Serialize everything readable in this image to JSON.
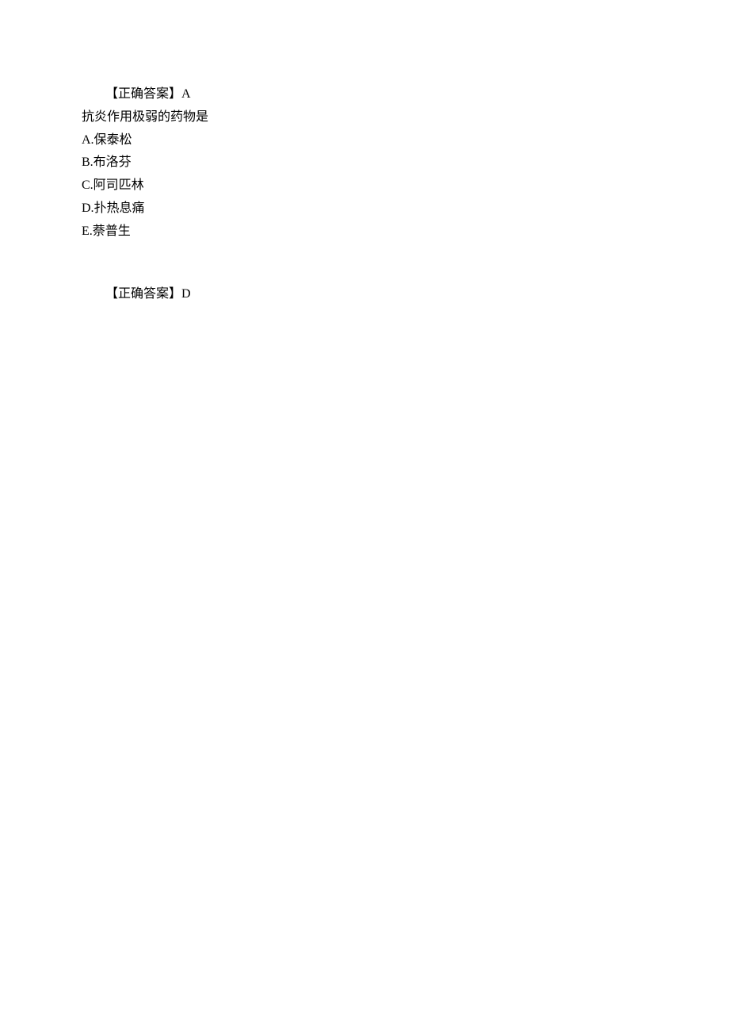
{
  "block1": {
    "answer_label": "【正确答案】A"
  },
  "block2": {
    "question": "抗炎作用极弱的药物是",
    "options": {
      "a": "A.保泰松",
      "b": "B.布洛芬",
      "c": "C.阿司匹林",
      "d": "D.扑热息痛",
      "e": "E.萘普生"
    },
    "answer_label": "【正确答案】D"
  }
}
